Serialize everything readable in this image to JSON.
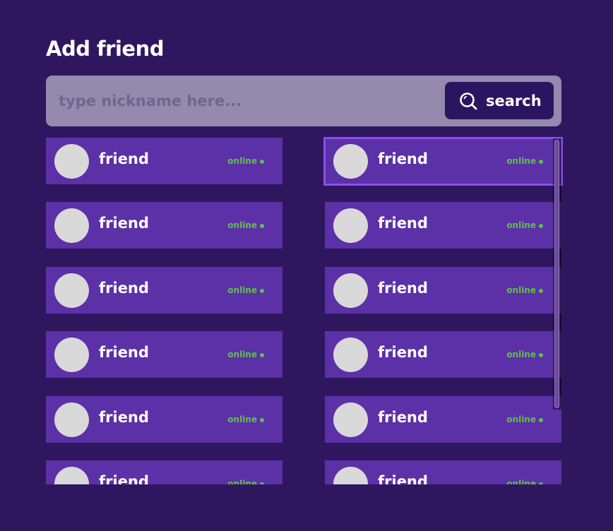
{
  "header": {
    "title": "Add friend"
  },
  "search": {
    "placeholder": "type nickname here...",
    "value": "",
    "button_label": "search",
    "button_icon": "search-icon"
  },
  "friends": [
    {
      "name": "friend",
      "status": "online"
    },
    {
      "name": "friend",
      "status": "online"
    },
    {
      "name": "friend",
      "status": "online"
    },
    {
      "name": "friend",
      "status": "online"
    },
    {
      "name": "friend",
      "status": "online"
    },
    {
      "name": "friend",
      "status": "online"
    },
    {
      "name": "friend",
      "status": "online"
    },
    {
      "name": "friend",
      "status": "online"
    },
    {
      "name": "friend",
      "status": "online"
    },
    {
      "name": "friend",
      "status": "online"
    },
    {
      "name": "friend",
      "status": "online"
    },
    {
      "name": "friend",
      "status": "online"
    }
  ],
  "colors": {
    "background": "#2e175f",
    "card": "#5c30a7",
    "card_selected_border": "#8c4ef0",
    "search_bar": "#938aad",
    "search_button": "#2c1560",
    "online": "#5fc04a",
    "avatar": "#d9d9d9"
  }
}
